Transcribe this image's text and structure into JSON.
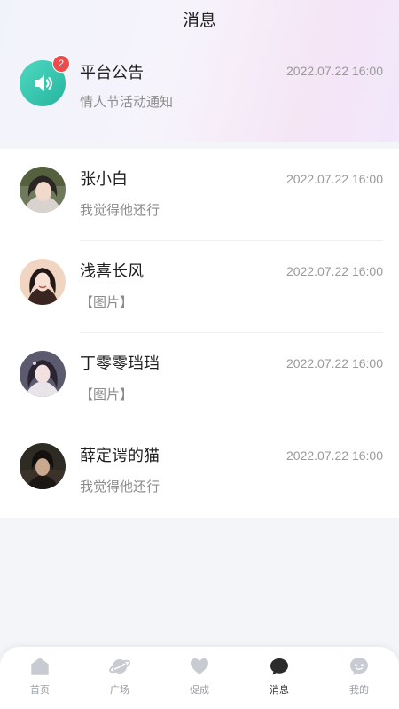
{
  "header": {
    "title": "消息"
  },
  "announcement": {
    "title": "平台公告",
    "preview": "情人节活动通知",
    "time": "2022.07.22 16:00",
    "badge": "2",
    "icon": "speaker-icon",
    "accent": "#2fc0a8"
  },
  "messages": [
    {
      "name": "张小白",
      "preview": "我觉得他还行",
      "time": "2022.07.22 16:00"
    },
    {
      "name": "浅喜长风",
      "preview": "【图片】",
      "time": "2022.07.22 16:00"
    },
    {
      "name": "丁零零珰珰",
      "preview": "【图片】",
      "time": "2022.07.22 16:00"
    },
    {
      "name": "薛定谔的猫",
      "preview": "我觉得他还行",
      "time": "2022.07.22 16:00"
    }
  ],
  "tabbar": {
    "items": [
      {
        "label": "首页",
        "icon": "home-icon"
      },
      {
        "label": "广场",
        "icon": "planet-icon"
      },
      {
        "label": "促成",
        "icon": "heart-icon"
      },
      {
        "label": "消息",
        "icon": "chat-bubble-icon",
        "active": true
      },
      {
        "label": "我的",
        "icon": "profile-face-icon"
      }
    ],
    "active_color": "#2b2b2b",
    "inactive_color": "#c8cbd1"
  }
}
